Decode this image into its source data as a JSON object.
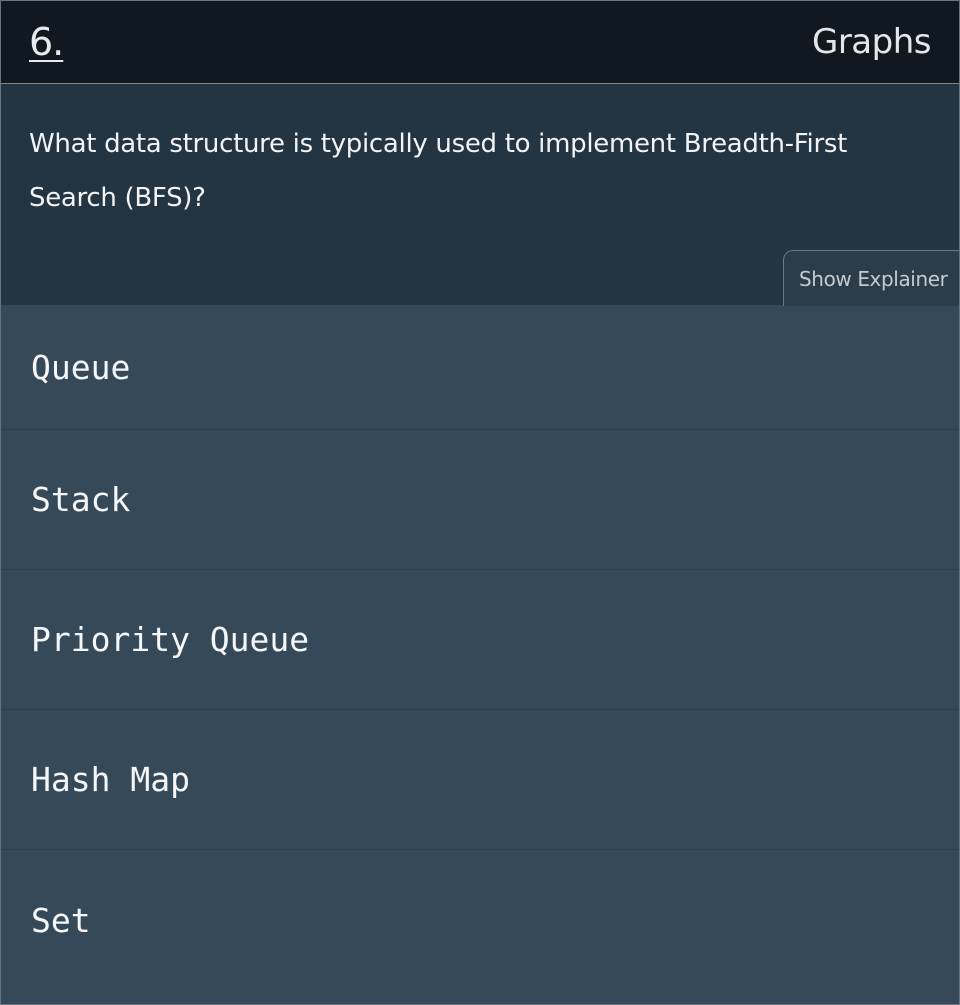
{
  "header": {
    "question_number": "6.",
    "topic": "Graphs"
  },
  "question": {
    "text": "What data structure is typically used to implement Breadth-First Search (BFS)?"
  },
  "explainer": {
    "label": "Show Explainer"
  },
  "answers": [
    {
      "label": "Queue"
    },
    {
      "label": "Stack"
    },
    {
      "label": "Priority Queue"
    },
    {
      "label": "Hash Map"
    },
    {
      "label": "Set"
    }
  ],
  "colors": {
    "header_background": "#101820",
    "prompt_background": "#233442",
    "answer_background": "#364958"
  }
}
